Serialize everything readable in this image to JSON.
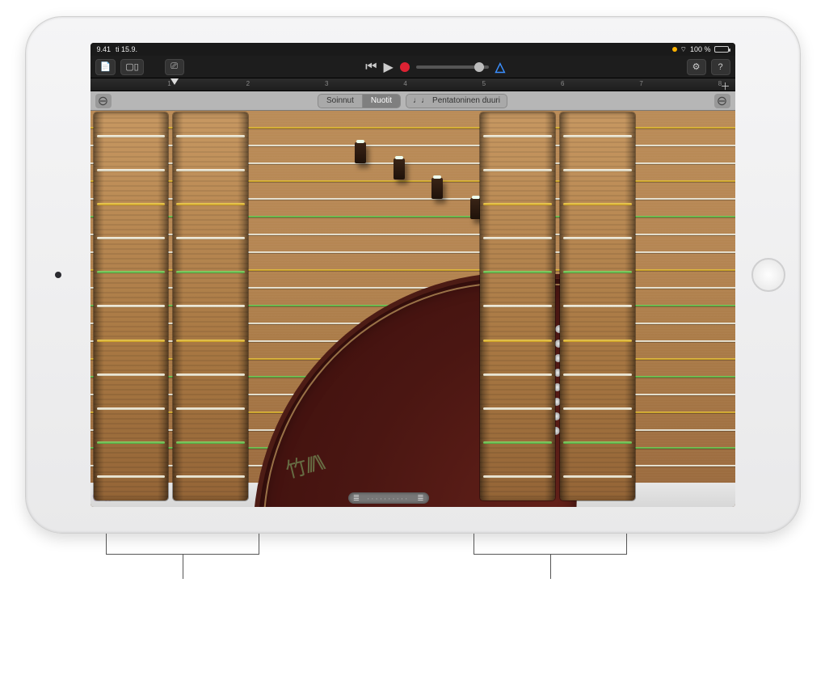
{
  "status": {
    "time": "9.41",
    "date": "ti 15.9.",
    "battery_pct": "100 %"
  },
  "ruler": {
    "bars": [
      "1",
      "2",
      "3",
      "4",
      "5",
      "6",
      "7",
      "8"
    ]
  },
  "segmented": {
    "chords": "Soinnut",
    "notes": "Nuotit",
    "scale": "Pentatoninen duuri"
  },
  "chord_strip_pattern": [
    "wh",
    "wh",
    "yl",
    "wh",
    "gn",
    "wh",
    "yl",
    "wh",
    "wh",
    "gn",
    "wh"
  ],
  "main_strings": [
    "yl",
    "wh",
    "wh",
    "yl",
    "wh",
    "gn",
    "wh",
    "wh",
    "yl",
    "wh",
    "gn",
    "wh",
    "wh",
    "yl",
    "gn",
    "wh",
    "yl",
    "wh",
    "gn",
    "wh"
  ],
  "icons": {
    "file": "📄",
    "view": "▢▯",
    "mixer": "⎚",
    "prev": "⏮",
    "play": "▶",
    "metronome": "△",
    "settings": "⚙",
    "help": "?",
    "zoom_out": "⊖",
    "plus": "＋",
    "wifi": "⌔",
    "scale_glyph": "♩♩"
  }
}
